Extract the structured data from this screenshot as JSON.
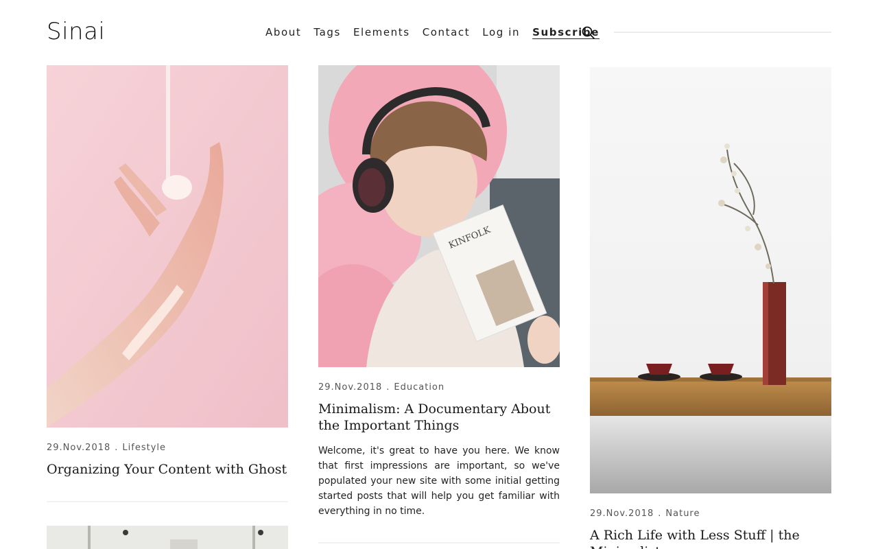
{
  "site": {
    "logo": "Sinai"
  },
  "nav": {
    "items": [
      {
        "label": "About"
      },
      {
        "label": "Tags"
      },
      {
        "label": "Elements"
      },
      {
        "label": "Contact"
      },
      {
        "label": "Log in"
      },
      {
        "label": "Subscribe"
      }
    ],
    "search_icon": "search-icon"
  },
  "posts": [
    {
      "date": "29.Nov.2018",
      "category": "Lifestyle",
      "title": "Organizing Your Content with Ghost",
      "image": "pink-hand-paint-photo"
    },
    {
      "date": "29.Nov.2018",
      "category": "Education",
      "title": "Minimalism: A Documentary About the Important Things",
      "excerpt": "Welcome, it's great to have you here. We know that first impressions are important, so we've populated your new site with some initial getting started posts that will help you get familiar with everything in no time.",
      "image": "woman-headphones-magazine-photo",
      "magazine_text": "KINFOLK"
    },
    {
      "date": "29.Nov.2018",
      "category": "Nature",
      "title": "A Rich Life with Less Stuff | the Minimalists",
      "image": "vase-tea-cups-shelf-photo"
    },
    {
      "image": "interior-photo-partial"
    }
  ],
  "colors": {
    "accent_red": "#8b2a25",
    "pink_bg": "#f3c9d0",
    "wood": "#b5823f"
  }
}
